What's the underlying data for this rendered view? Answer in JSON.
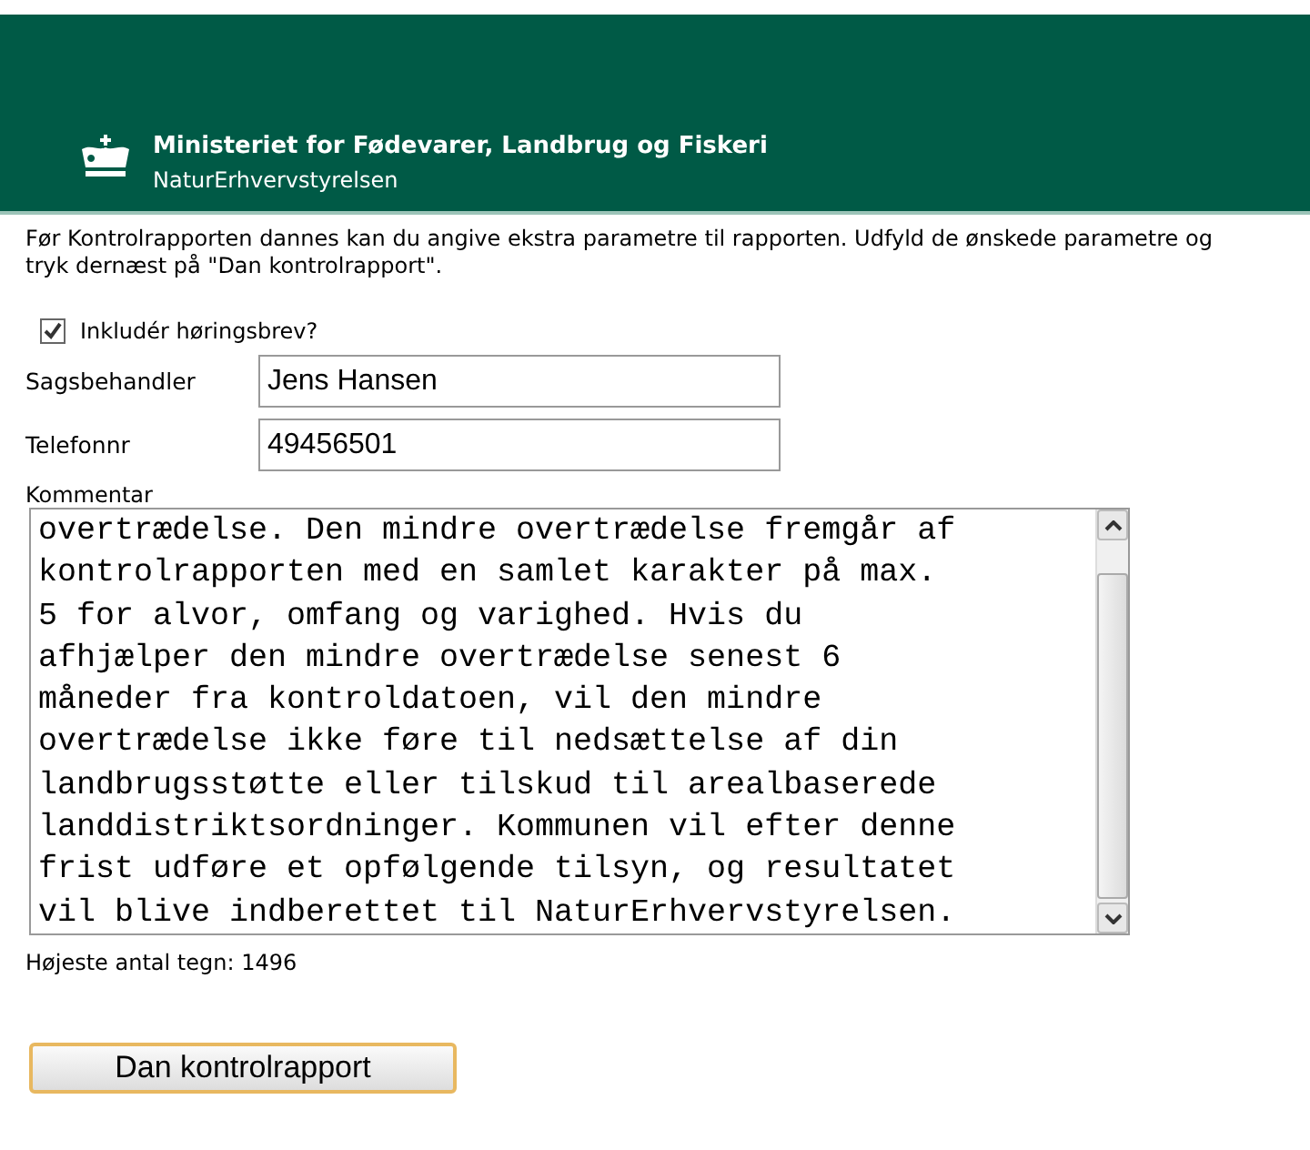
{
  "header": {
    "title": "Ministeriet for Fødevarer, Landbrug og Fiskeri",
    "subtitle": "NaturErhvervstyrelsen"
  },
  "intro": "Før Kontrolrapporten dannes kan du angive ekstra parametre til rapporten. Udfyld de ønskede parametre og tryk dernæst på \"Dan kontrolrapport\".",
  "include_letter": {
    "label": "Inkludér høringsbrev?",
    "checked": true
  },
  "fields": [
    {
      "label": "Sagsbehandler",
      "value": "Jens Hansen"
    },
    {
      "label": "Telefonnr",
      "value": "49456501"
    }
  ],
  "comment": {
    "label": "Kommentar",
    "lines": [
      "overtrædelse. Den mindre overtrædelse fremgår af",
      "kontrolrapporten med en samlet karakter på max.",
      "5 for alvor, omfang og varighed. Hvis du",
      "afhjælper den mindre overtrædelse senest 6",
      "måneder fra kontroldatoen, vil den mindre",
      "overtrædelse ikke føre til nedsættelse af din",
      "landbrugsstøtte eller tilskud til arealbaserede",
      "landdistriktsordninger. Kommunen vil efter denne",
      "frist udføre et opfølgende tilsyn, og resultatet",
      "vil blive indberettet til NaturErhvervstyrelsen."
    ],
    "max_chars": "Højeste antal tegn: 1496"
  },
  "button": "Dan kontrolrapport"
}
